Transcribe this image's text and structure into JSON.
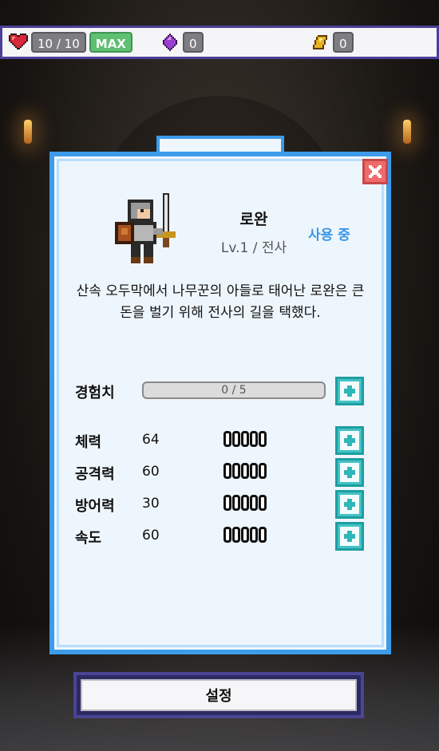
{
  "resources": {
    "hearts": "10 / 10",
    "hearts_badge": "MAX",
    "gems": "0",
    "gold": "0"
  },
  "character": {
    "name": "로완",
    "level": "Lv.1 / 전사",
    "status": "사용 중",
    "description": "산속 오두막에서 나무꾼의 아들로 태어난 로완은 큰돈을 벌기 위해 전사의 길을 택했다."
  },
  "experience": {
    "label": "경험치",
    "text": "0 / 5",
    "progress": 0
  },
  "stats": [
    {
      "label": "체력",
      "value": "64",
      "level": 0
    },
    {
      "label": "공격력",
      "value": "60",
      "level": 0
    },
    {
      "label": "방어력",
      "value": "30",
      "level": 0
    },
    {
      "label": "속도",
      "value": "60",
      "level": 0
    }
  ],
  "buttons": {
    "settings": "설정"
  },
  "colors": {
    "panel_border": "#3d9be9",
    "accent_blue": "#3a96e6",
    "plus_button": "#42c3c6",
    "close_button": "#ef6b6b",
    "topbar_border": "#4c3f9a"
  },
  "icons": [
    "heart-icon",
    "gem-icon",
    "gold-icon",
    "close-icon",
    "plus-icon",
    "warrior-avatar"
  ]
}
